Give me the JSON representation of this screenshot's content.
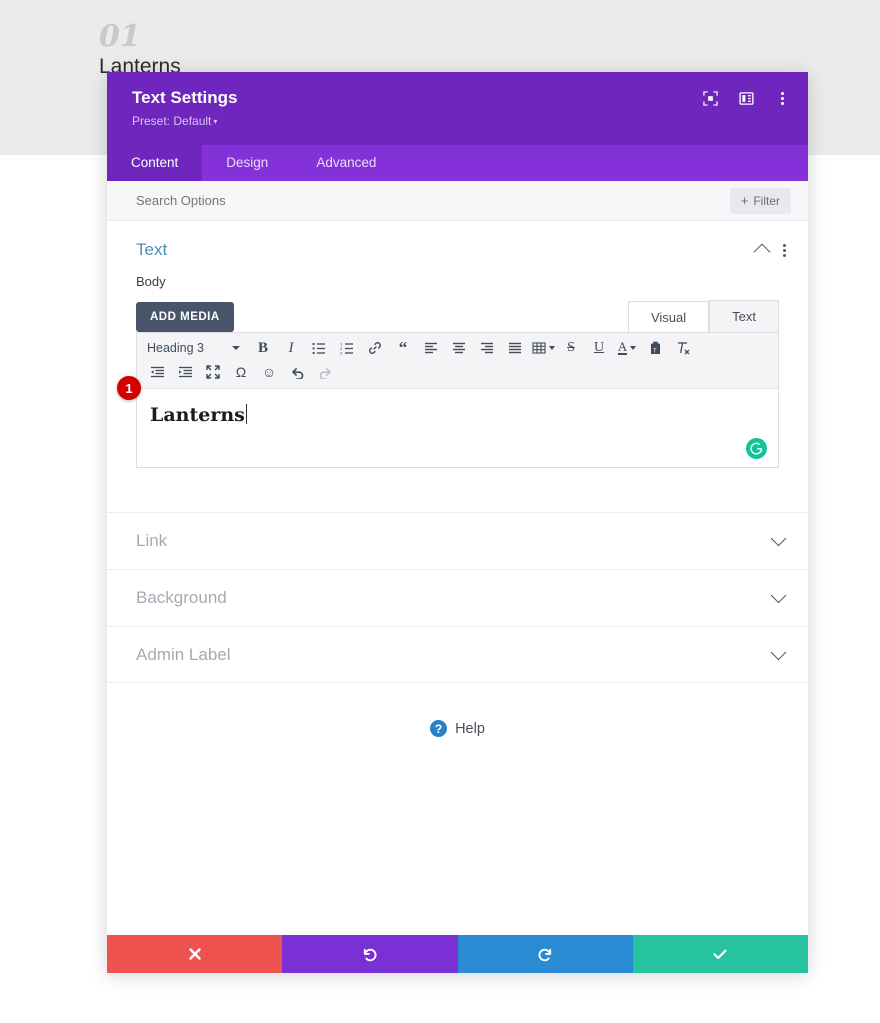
{
  "page": {
    "number": "01",
    "title": "Lanterns"
  },
  "modal": {
    "title": "Text Settings",
    "preset": "Preset: Default",
    "preset_caret": "▾",
    "header_icons": [
      {
        "name": "focus-mode-icon",
        "label": "Focus Mode"
      },
      {
        "name": "panel-layout-icon",
        "label": "Change Panel Layout"
      },
      {
        "name": "more-options-icon",
        "label": "More Options"
      }
    ],
    "tabs": [
      {
        "label": "Content",
        "active": true
      },
      {
        "label": "Design",
        "active": false
      },
      {
        "label": "Advanced",
        "active": false
      }
    ],
    "search": {
      "placeholder": "Search Options",
      "value": ""
    },
    "filter_button": {
      "plus": "+",
      "label": "Filter"
    },
    "section_text": {
      "title": "Text",
      "collapse_icon": "chevron-up",
      "menu_icon": "kebab"
    },
    "body_field": {
      "label": "Body",
      "add_media_label": "ADD MEDIA",
      "editor_tabs": [
        {
          "label": "Visual",
          "active": true
        },
        {
          "label": "Text",
          "active": false
        }
      ],
      "format_select": "Heading 3",
      "toolbar_row1": [
        {
          "name": "bold-icon",
          "glyph": "B"
        },
        {
          "name": "italic-icon",
          "glyph": "I"
        },
        {
          "name": "bulleted-list-icon",
          "glyph": "☰"
        },
        {
          "name": "numbered-list-icon",
          "glyph": "☰"
        },
        {
          "name": "link-icon",
          "glyph": "🔗"
        },
        {
          "name": "blockquote-icon",
          "glyph": "“"
        },
        {
          "name": "align-left-icon",
          "glyph": "≡"
        },
        {
          "name": "align-center-icon",
          "glyph": "≡"
        },
        {
          "name": "align-right-icon",
          "glyph": "≡"
        },
        {
          "name": "align-justify-icon",
          "glyph": "≡"
        },
        {
          "name": "table-icon",
          "glyph": "▦"
        },
        {
          "name": "strikethrough-icon",
          "glyph": "S"
        },
        {
          "name": "underline-icon",
          "glyph": "U"
        },
        {
          "name": "text-color-icon",
          "glyph": "A"
        },
        {
          "name": "paste-as-text-icon",
          "glyph": "📋"
        },
        {
          "name": "clear-formatting-icon",
          "glyph": "Tx"
        }
      ],
      "toolbar_row2": [
        {
          "name": "outdent-icon",
          "glyph": "⇤"
        },
        {
          "name": "indent-icon",
          "glyph": "⇥"
        },
        {
          "name": "fullscreen-icon",
          "glyph": "⛶"
        },
        {
          "name": "special-character-icon",
          "glyph": "Ω"
        },
        {
          "name": "emoji-icon",
          "glyph": "☺"
        },
        {
          "name": "undo-icon",
          "glyph": "↶"
        },
        {
          "name": "redo-icon",
          "glyph": "↷"
        }
      ],
      "content_text": "Lanterns",
      "grammarly_letter": "G",
      "step_badge": "1"
    },
    "accordions": [
      {
        "label": "Link"
      },
      {
        "label": "Background"
      },
      {
        "label": "Admin Label"
      }
    ],
    "help": {
      "icon_glyph": "?",
      "label": "Help"
    },
    "footer_buttons": [
      {
        "name": "cancel-button",
        "glyph": "✕",
        "color": "#ef5350"
      },
      {
        "name": "undo-button",
        "glyph": "↺",
        "color": "#7930d4"
      },
      {
        "name": "redo-button",
        "glyph": "↻",
        "color": "#2a8ad4"
      },
      {
        "name": "save-button",
        "glyph": "✔",
        "color": "#27c2a0"
      }
    ]
  },
  "colors": {
    "header_purple": "#6f26be",
    "tab_purple": "#8431d9",
    "section_title_blue": "#4b8fb5",
    "add_media_slate": "#48546a",
    "grammarly_green": "#15c39a",
    "badge_red": "#d40000",
    "page_band_gray": "#ebebeb"
  }
}
